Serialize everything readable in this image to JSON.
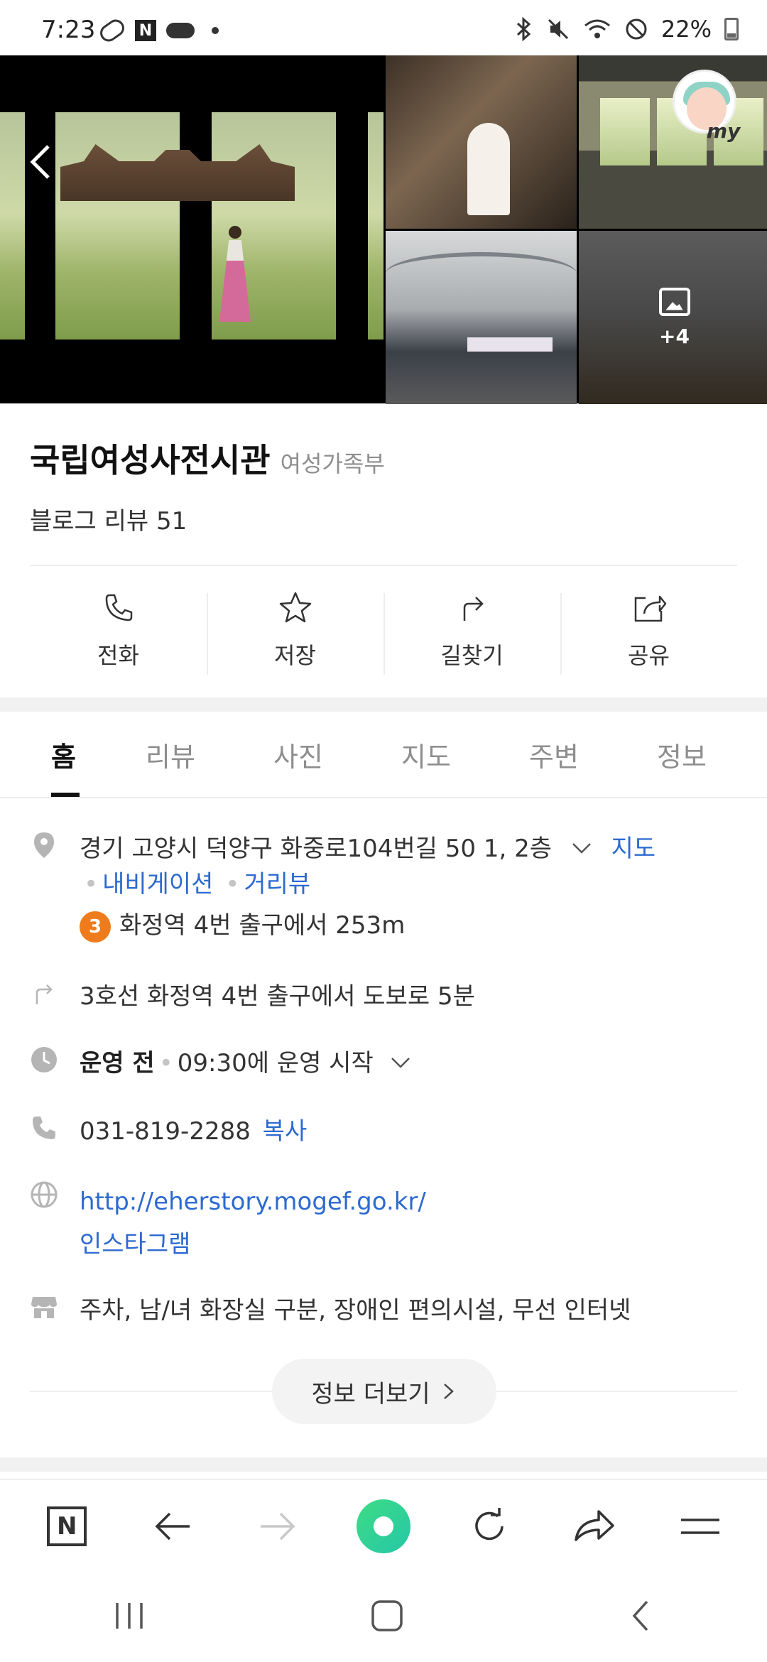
{
  "status_bar": {
    "time": "7:23",
    "battery": "22%"
  },
  "gallery": {
    "more_count": "+4",
    "my_label": "my"
  },
  "place": {
    "name": "국립여성사전시관",
    "category": "여성가족부",
    "blog_review": "블로그 리뷰 51"
  },
  "actions": [
    {
      "label": "전화",
      "icon": "phone-icon"
    },
    {
      "label": "저장",
      "icon": "star-icon"
    },
    {
      "label": "길찾기",
      "icon": "directions-icon"
    },
    {
      "label": "공유",
      "icon": "share-icon"
    }
  ],
  "tabs": [
    "홈",
    "리뷰",
    "사진",
    "지도",
    "주변",
    "정보"
  ],
  "info": {
    "address": "경기 고양시 덕양구 화중로104번길 50 1, 2층",
    "map_link": "지도",
    "navigation_link": "내비게이션",
    "street_view_link": "거리뷰",
    "subway_line": "3",
    "subway_text": "화정역 4번 출구에서 253m",
    "walk_text": "3호선 화정역 4번 출구에서 도보로 5분",
    "hours_status": "운영 전",
    "hours_detail": "09:30에 운영 시작",
    "phone": "031-819-2288",
    "copy_link": "복사",
    "website": "http://eherstory.mogef.go.kr/",
    "instagram": "인스타그램",
    "facilities": "주차, 남/녀 화장실 구분, 장애인 편의시설, 무선 인터넷",
    "more_info": "정보 더보기"
  },
  "colors": {
    "link": "#2d6ad0",
    "subway_line_3": "#ef7c1c",
    "accent_green": "#3ddc84"
  }
}
